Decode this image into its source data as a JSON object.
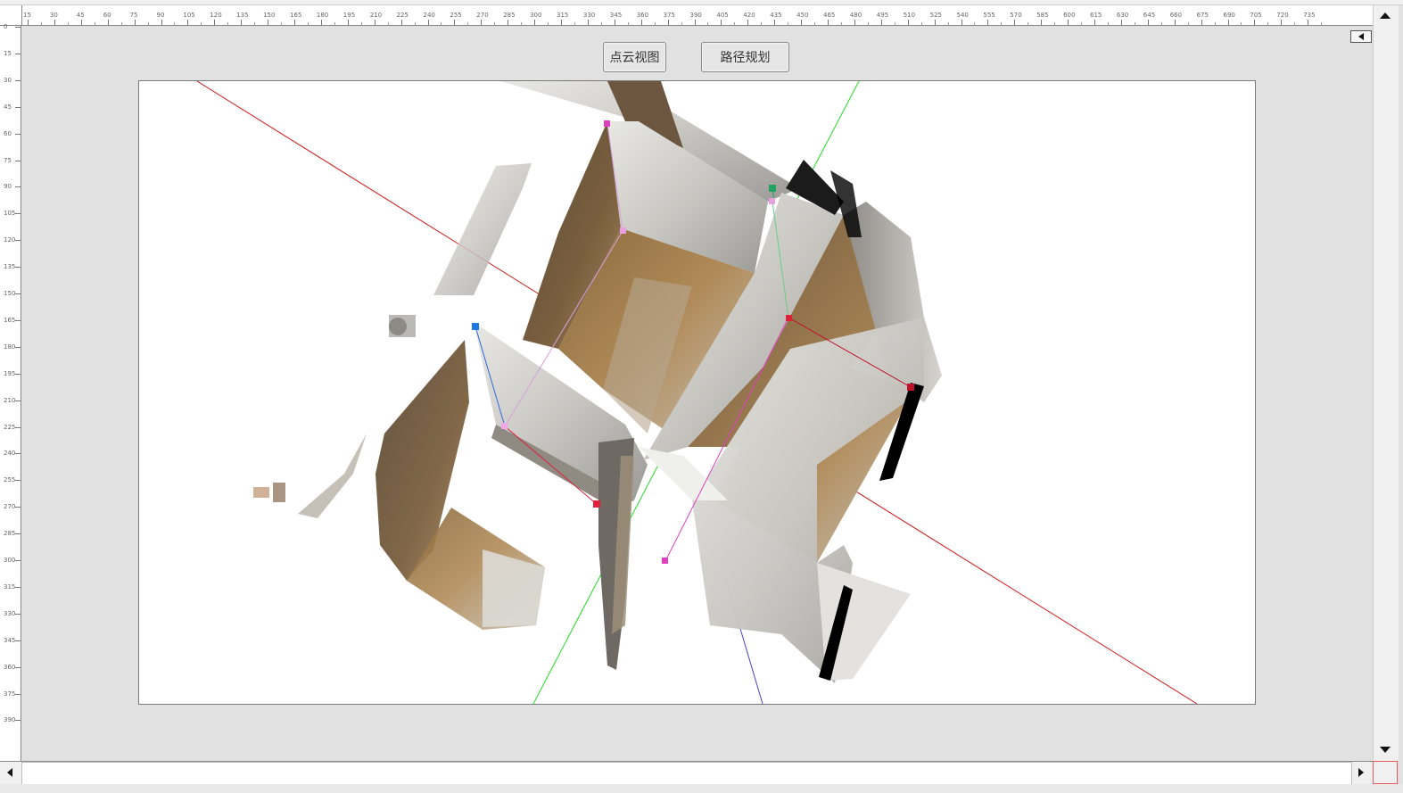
{
  "toolbar": {
    "pointcloud_label": "点云视图",
    "pathplan_label": "路径规划"
  },
  "ruler": {
    "h_ticks": [
      "15",
      "30",
      "45",
      "60",
      "75",
      "90",
      "105",
      "120",
      "135",
      "150",
      "165",
      "180",
      "195",
      "210",
      "225",
      "240",
      "255",
      "270",
      "285",
      "300",
      "315",
      "330",
      "345",
      "360",
      "375",
      "390",
      "405",
      "420",
      "435",
      "450",
      "465",
      "480",
      "495",
      "510",
      "525",
      "540",
      "555",
      "570",
      "585",
      "600",
      "615",
      "630",
      "645",
      "660",
      "675",
      "690",
      "705",
      "720",
      "735"
    ],
    "v_ticks": [
      "0",
      "15",
      "30",
      "45",
      "60",
      "75",
      "90",
      "105",
      "120",
      "135",
      "150",
      "165",
      "180",
      "195",
      "210",
      "225",
      "240",
      "255",
      "270",
      "285",
      "300",
      "315",
      "330",
      "345",
      "360",
      "375",
      "390"
    ]
  },
  "icons": {
    "collapse": "triangle-left-icon",
    "scroll_up": "arrow-up-icon",
    "scroll_down": "arrow-down-icon",
    "scroll_left": "arrow-left-icon",
    "scroll_right": "arrow-right-icon"
  },
  "colors": {
    "axis_x": "#d01818",
    "axis_y": "#22dd22",
    "axis_z": "#2222cc",
    "marker_pink": "#e040c0",
    "marker_red": "#e0203c",
    "marker_blue": "#1e78e6",
    "marker_green": "#24a060"
  }
}
